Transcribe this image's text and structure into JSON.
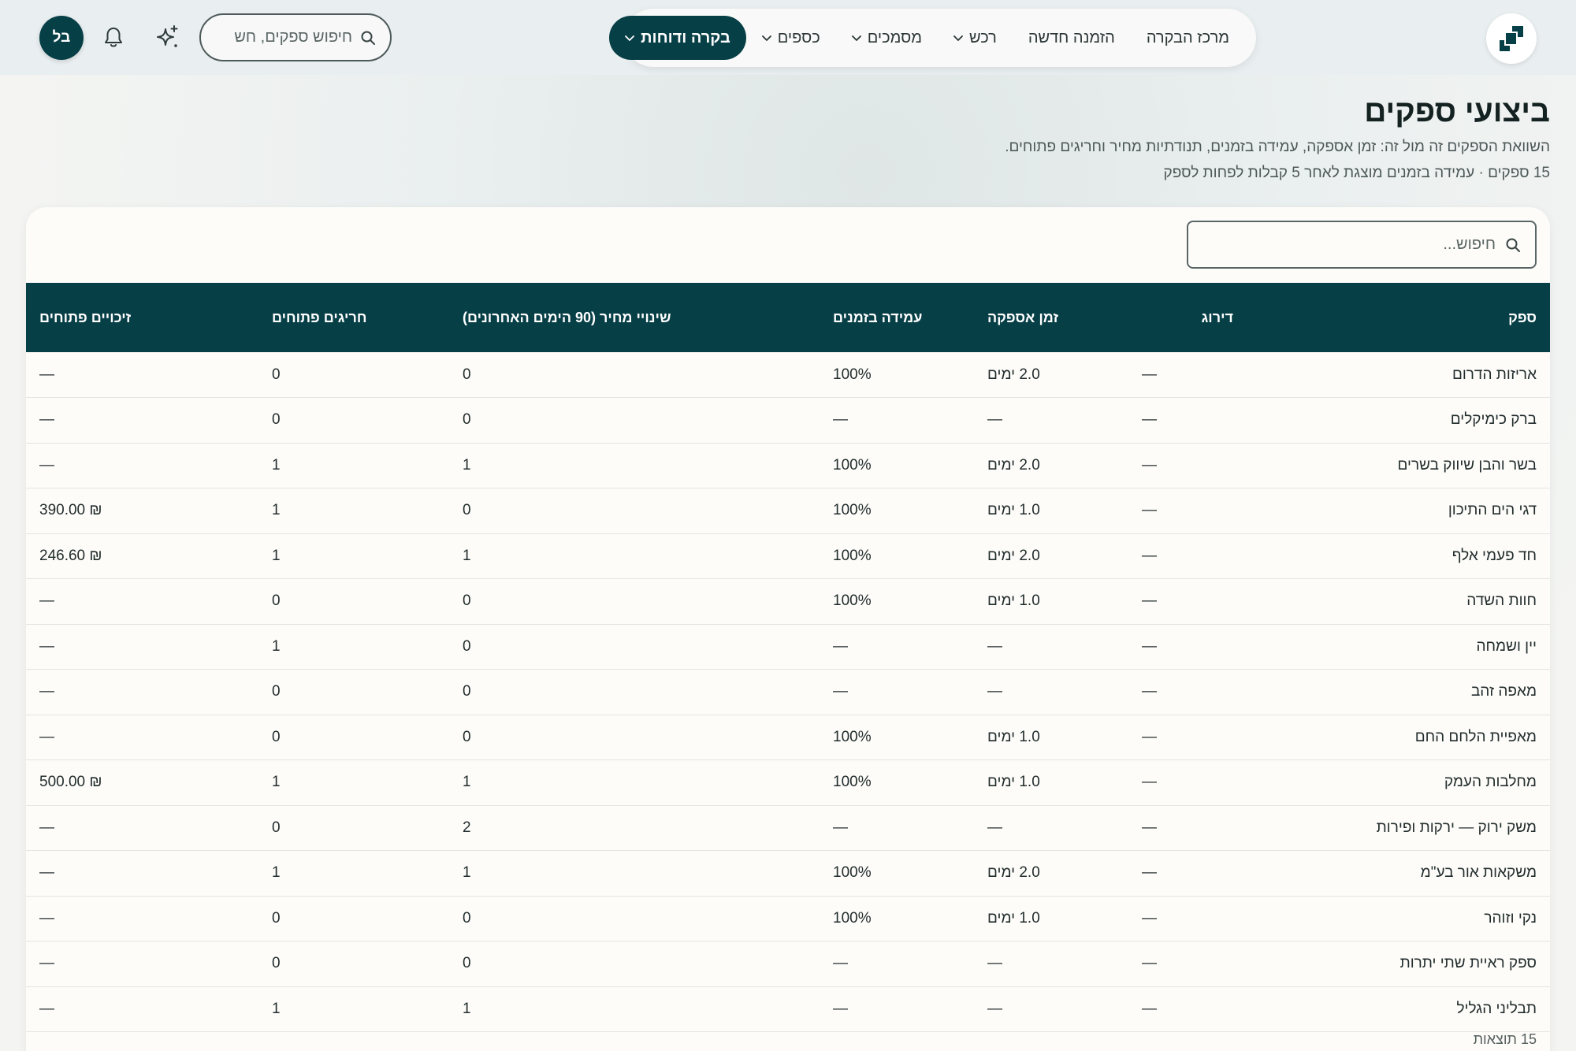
{
  "nav": {
    "items": [
      {
        "label": "מרכז הבקרה",
        "dropdown": false,
        "active": false
      },
      {
        "label": "הזמנה חדשה",
        "dropdown": false,
        "active": false
      },
      {
        "label": "רכש",
        "dropdown": true,
        "active": false
      },
      {
        "label": "מסמכים",
        "dropdown": true,
        "active": false
      },
      {
        "label": "כספים",
        "dropdown": true,
        "active": false
      },
      {
        "label": "בקרה ודוחות",
        "dropdown": true,
        "active": true
      }
    ],
    "search_placeholder": "חיפוש ספקים, חש",
    "avatar_initials": "בל",
    "accent": "#073f47"
  },
  "page": {
    "title": "ביצועי ספקים",
    "subtitle": "השוואת הספקים זה מול זה: זמן אספקה, עמידה בזמנים, תנודתיות מחיר וחריגים פתוחים.",
    "meta": "15 ספקים · עמידה בזמנים מוצגת לאחר 5 קבלות לפחות לספק"
  },
  "table": {
    "search_placeholder": "חיפוש...",
    "headers": {
      "supplier": "ספק",
      "rating": "דירוג",
      "lead_time": "זמן אספקה",
      "on_time": "עמידה בזמנים",
      "price_change": "שינויי מחיר (90 הימים האחרונים)",
      "exceptions": "חריגים פתוחים",
      "credits": "זיכויים פתוחים"
    },
    "rows": [
      {
        "supplier": "אריזות הדרום",
        "rating": "—",
        "lead_time": "2.0 ימים",
        "on_time": "100%",
        "price_change": "0",
        "exceptions": "0",
        "credits": "—"
      },
      {
        "supplier": "ברק כימיקלים",
        "rating": "—",
        "lead_time": "—",
        "on_time": "—",
        "price_change": "0",
        "exceptions": "0",
        "credits": "—"
      },
      {
        "supplier": "בשר והבן שיווק בשרים",
        "rating": "—",
        "lead_time": "2.0 ימים",
        "on_time": "100%",
        "price_change": "1",
        "exceptions": "1",
        "credits": "—"
      },
      {
        "supplier": "דגי הים התיכון",
        "rating": "—",
        "lead_time": "1.0 ימים",
        "on_time": "100%",
        "price_change": "0",
        "exceptions": "1",
        "credits": "₪ 390.00"
      },
      {
        "supplier": "חד פעמי אלף",
        "rating": "—",
        "lead_time": "2.0 ימים",
        "on_time": "100%",
        "price_change": "1",
        "exceptions": "1",
        "credits": "₪ 246.60"
      },
      {
        "supplier": "חוות השדה",
        "rating": "—",
        "lead_time": "1.0 ימים",
        "on_time": "100%",
        "price_change": "0",
        "exceptions": "0",
        "credits": "—"
      },
      {
        "supplier": "יין ושמחה",
        "rating": "—",
        "lead_time": "—",
        "on_time": "—",
        "price_change": "0",
        "exceptions": "1",
        "credits": "—"
      },
      {
        "supplier": "מאפה זהב",
        "rating": "—",
        "lead_time": "—",
        "on_time": "—",
        "price_change": "0",
        "exceptions": "0",
        "credits": "—"
      },
      {
        "supplier": "מאפיית הלחם החם",
        "rating": "—",
        "lead_time": "1.0 ימים",
        "on_time": "100%",
        "price_change": "0",
        "exceptions": "0",
        "credits": "—"
      },
      {
        "supplier": "מחלבות העמק",
        "rating": "—",
        "lead_time": "1.0 ימים",
        "on_time": "100%",
        "price_change": "1",
        "exceptions": "1",
        "credits": "₪ 500.00"
      },
      {
        "supplier": "משק ירוק — ירקות ופירות",
        "rating": "—",
        "lead_time": "—",
        "on_time": "—",
        "price_change": "2",
        "exceptions": "0",
        "credits": "—"
      },
      {
        "supplier": "משקאות אור בע\"מ",
        "rating": "—",
        "lead_time": "2.0 ימים",
        "on_time": "100%",
        "price_change": "1",
        "exceptions": "1",
        "credits": "—"
      },
      {
        "supplier": "נקי וזוהר",
        "rating": "—",
        "lead_time": "1.0 ימים",
        "on_time": "100%",
        "price_change": "0",
        "exceptions": "0",
        "credits": "—"
      },
      {
        "supplier": "ספק ראיית שתי יתרות",
        "rating": "—",
        "lead_time": "—",
        "on_time": "—",
        "price_change": "0",
        "exceptions": "0",
        "credits": "—"
      },
      {
        "supplier": "תבליני הגליל",
        "rating": "—",
        "lead_time": "—",
        "on_time": "—",
        "price_change": "1",
        "exceptions": "1",
        "credits": "—"
      }
    ],
    "footer": "15 תוצאות"
  }
}
